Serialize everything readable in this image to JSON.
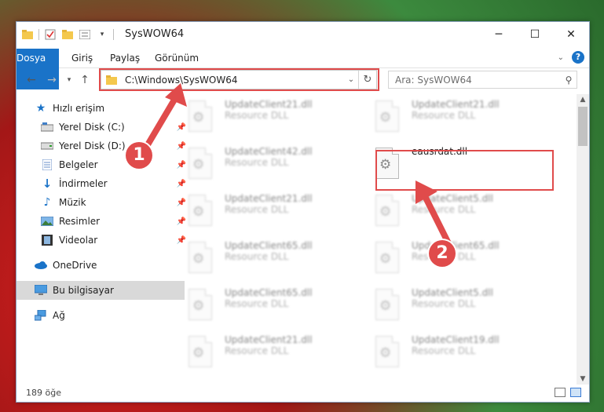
{
  "window": {
    "title": "SysWOW64"
  },
  "ribbon": {
    "tabs": [
      "Dosya",
      "Giriş",
      "Paylaş",
      "Görünüm"
    ]
  },
  "address": {
    "path": "C:\\Windows\\SysWOW64"
  },
  "search": {
    "placeholder": "Ara: SysWOW64"
  },
  "sidebar": {
    "items": [
      {
        "label": "Hızlı erişim",
        "icon": "star-icon"
      },
      {
        "label": "Yerel Disk (C:)",
        "icon": "drive-icon"
      },
      {
        "label": "Yerel Disk (D:)",
        "icon": "drive-icon"
      },
      {
        "label": "Belgeler",
        "icon": "documents-icon"
      },
      {
        "label": "İndirmeler",
        "icon": "download-icon"
      },
      {
        "label": "Müzik",
        "icon": "music-icon"
      },
      {
        "label": "Resimler",
        "icon": "pictures-icon"
      },
      {
        "label": "Videolar",
        "icon": "videos-icon"
      },
      {
        "label": "OneDrive",
        "icon": "cloud-icon"
      },
      {
        "label": "Bu bilgisayar",
        "icon": "computer-icon"
      },
      {
        "label": "Ağ",
        "icon": "network-icon"
      }
    ]
  },
  "files": {
    "left": [
      {
        "name": "UpdateClient21.dll",
        "type": "Resource DLL"
      },
      {
        "name": "UpdateClient42.dll",
        "type": "Resource DLL"
      },
      {
        "name": "UpdateClient21.dll",
        "type": "Resource DLL"
      },
      {
        "name": "UpdateClient65.dll",
        "type": "Resource DLL"
      },
      {
        "name": "UpdateClient65.dll",
        "type": "Resource DLL"
      },
      {
        "name": "UpdateClient21.dll",
        "type": "Resource DLL"
      }
    ],
    "right": [
      {
        "name": "UpdateClient21.dll",
        "type": "Resource DLL"
      },
      {
        "name": "eausrdat.dll",
        "type": ""
      },
      {
        "name": "UpdateClient5.dll",
        "type": "Resource DLL"
      },
      {
        "name": "UpdateClient65.dll",
        "type": "Resource DLL"
      },
      {
        "name": "UpdateClient5.dll",
        "type": "Resource DLL"
      },
      {
        "name": "UpdateClient19.dll",
        "type": "Resource DLL"
      }
    ]
  },
  "status": {
    "count": "189 öğe"
  },
  "callouts": {
    "one": "1",
    "two": "2"
  },
  "colors": {
    "accent": "#1a73c8",
    "highlight": "#e04b4b"
  }
}
